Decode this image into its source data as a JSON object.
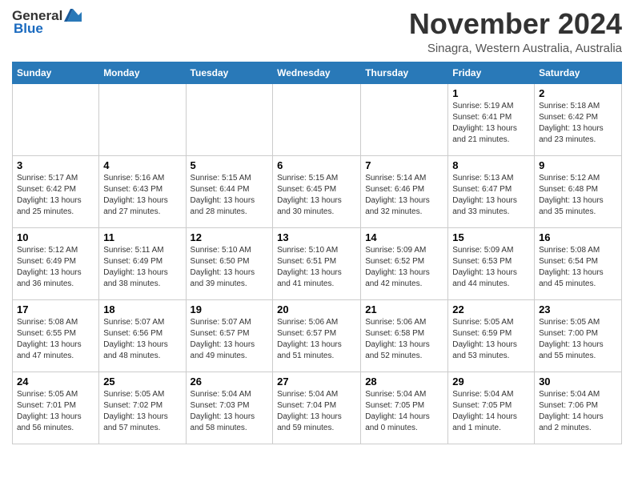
{
  "header": {
    "logo_general": "General",
    "logo_blue": "Blue",
    "month": "November 2024",
    "location": "Sinagra, Western Australia, Australia"
  },
  "weekdays": [
    "Sunday",
    "Monday",
    "Tuesday",
    "Wednesday",
    "Thursday",
    "Friday",
    "Saturday"
  ],
  "weeks": [
    [
      {
        "day": "",
        "info": ""
      },
      {
        "day": "",
        "info": ""
      },
      {
        "day": "",
        "info": ""
      },
      {
        "day": "",
        "info": ""
      },
      {
        "day": "",
        "info": ""
      },
      {
        "day": "1",
        "info": "Sunrise: 5:19 AM\nSunset: 6:41 PM\nDaylight: 13 hours and 21 minutes."
      },
      {
        "day": "2",
        "info": "Sunrise: 5:18 AM\nSunset: 6:42 PM\nDaylight: 13 hours and 23 minutes."
      }
    ],
    [
      {
        "day": "3",
        "info": "Sunrise: 5:17 AM\nSunset: 6:42 PM\nDaylight: 13 hours and 25 minutes."
      },
      {
        "day": "4",
        "info": "Sunrise: 5:16 AM\nSunset: 6:43 PM\nDaylight: 13 hours and 27 minutes."
      },
      {
        "day": "5",
        "info": "Sunrise: 5:15 AM\nSunset: 6:44 PM\nDaylight: 13 hours and 28 minutes."
      },
      {
        "day": "6",
        "info": "Sunrise: 5:15 AM\nSunset: 6:45 PM\nDaylight: 13 hours and 30 minutes."
      },
      {
        "day": "7",
        "info": "Sunrise: 5:14 AM\nSunset: 6:46 PM\nDaylight: 13 hours and 32 minutes."
      },
      {
        "day": "8",
        "info": "Sunrise: 5:13 AM\nSunset: 6:47 PM\nDaylight: 13 hours and 33 minutes."
      },
      {
        "day": "9",
        "info": "Sunrise: 5:12 AM\nSunset: 6:48 PM\nDaylight: 13 hours and 35 minutes."
      }
    ],
    [
      {
        "day": "10",
        "info": "Sunrise: 5:12 AM\nSunset: 6:49 PM\nDaylight: 13 hours and 36 minutes."
      },
      {
        "day": "11",
        "info": "Sunrise: 5:11 AM\nSunset: 6:49 PM\nDaylight: 13 hours and 38 minutes."
      },
      {
        "day": "12",
        "info": "Sunrise: 5:10 AM\nSunset: 6:50 PM\nDaylight: 13 hours and 39 minutes."
      },
      {
        "day": "13",
        "info": "Sunrise: 5:10 AM\nSunset: 6:51 PM\nDaylight: 13 hours and 41 minutes."
      },
      {
        "day": "14",
        "info": "Sunrise: 5:09 AM\nSunset: 6:52 PM\nDaylight: 13 hours and 42 minutes."
      },
      {
        "day": "15",
        "info": "Sunrise: 5:09 AM\nSunset: 6:53 PM\nDaylight: 13 hours and 44 minutes."
      },
      {
        "day": "16",
        "info": "Sunrise: 5:08 AM\nSunset: 6:54 PM\nDaylight: 13 hours and 45 minutes."
      }
    ],
    [
      {
        "day": "17",
        "info": "Sunrise: 5:08 AM\nSunset: 6:55 PM\nDaylight: 13 hours and 47 minutes."
      },
      {
        "day": "18",
        "info": "Sunrise: 5:07 AM\nSunset: 6:56 PM\nDaylight: 13 hours and 48 minutes."
      },
      {
        "day": "19",
        "info": "Sunrise: 5:07 AM\nSunset: 6:57 PM\nDaylight: 13 hours and 49 minutes."
      },
      {
        "day": "20",
        "info": "Sunrise: 5:06 AM\nSunset: 6:57 PM\nDaylight: 13 hours and 51 minutes."
      },
      {
        "day": "21",
        "info": "Sunrise: 5:06 AM\nSunset: 6:58 PM\nDaylight: 13 hours and 52 minutes."
      },
      {
        "day": "22",
        "info": "Sunrise: 5:05 AM\nSunset: 6:59 PM\nDaylight: 13 hours and 53 minutes."
      },
      {
        "day": "23",
        "info": "Sunrise: 5:05 AM\nSunset: 7:00 PM\nDaylight: 13 hours and 55 minutes."
      }
    ],
    [
      {
        "day": "24",
        "info": "Sunrise: 5:05 AM\nSunset: 7:01 PM\nDaylight: 13 hours and 56 minutes."
      },
      {
        "day": "25",
        "info": "Sunrise: 5:05 AM\nSunset: 7:02 PM\nDaylight: 13 hours and 57 minutes."
      },
      {
        "day": "26",
        "info": "Sunrise: 5:04 AM\nSunset: 7:03 PM\nDaylight: 13 hours and 58 minutes."
      },
      {
        "day": "27",
        "info": "Sunrise: 5:04 AM\nSunset: 7:04 PM\nDaylight: 13 hours and 59 minutes."
      },
      {
        "day": "28",
        "info": "Sunrise: 5:04 AM\nSunset: 7:05 PM\nDaylight: 14 hours and 0 minutes."
      },
      {
        "day": "29",
        "info": "Sunrise: 5:04 AM\nSunset: 7:05 PM\nDaylight: 14 hours and 1 minute."
      },
      {
        "day": "30",
        "info": "Sunrise: 5:04 AM\nSunset: 7:06 PM\nDaylight: 14 hours and 2 minutes."
      }
    ]
  ]
}
